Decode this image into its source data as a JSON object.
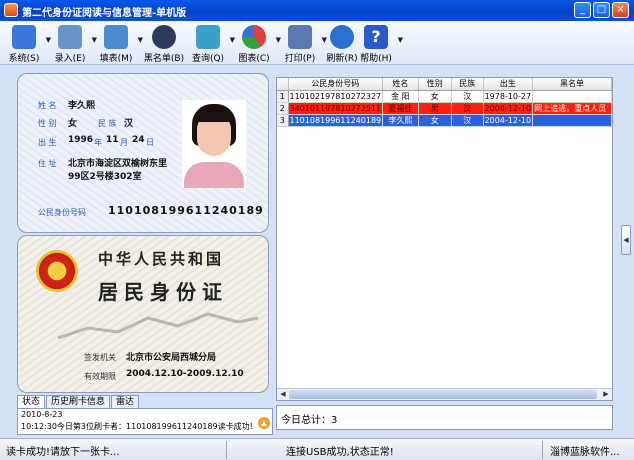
{
  "window": {
    "title": "第二代身份证阅读与信息管理-单机版",
    "min": "_",
    "max": "□",
    "close": "×"
  },
  "toolbar": [
    {
      "label": "系统(S)",
      "icon": "monitor-icon",
      "color": "#3a78d8",
      "has_dropdown": true
    },
    {
      "label": "录入(E)",
      "icon": "pen-icon",
      "color": "#6a94c8",
      "has_dropdown": true
    },
    {
      "label": "填表(M)",
      "icon": "clipboard-icon",
      "color": "#4a8ad0",
      "has_dropdown": true
    },
    {
      "label": "黑名单(B)",
      "icon": "person-icon",
      "color": "#2a3a5a",
      "has_dropdown": false
    },
    {
      "label": "查询(Q)",
      "icon": "search-document-icon",
      "color": "#3aa0c8",
      "has_dropdown": true
    },
    {
      "label": "图表(C)",
      "icon": "pie-chart-icon",
      "color": "#e04040",
      "has_dropdown": true
    },
    {
      "label": "打印(P)",
      "icon": "printer-icon",
      "color": "#5a7ab0",
      "has_dropdown": true
    },
    {
      "label": "刷新(R)",
      "icon": "refresh-icon",
      "color": "#2a70d0",
      "has_dropdown": false
    },
    {
      "label": "帮助(H)",
      "icon": "help-icon",
      "color": "#2a5ac8",
      "has_dropdown": true
    }
  ],
  "card": {
    "name_label": "姓 名",
    "name": "李久熙",
    "sex_label": "性 别",
    "sex": "女",
    "nation_label": "民 族",
    "nation": "汉",
    "birth_label": "出 生",
    "birth_year": "1996",
    "year_unit": "年",
    "birth_month": "11",
    "month_unit": "月",
    "birth_day": "24",
    "day_unit": "日",
    "address_label": "住 址",
    "address_line1": "北京市海淀区双榆树东里",
    "address_line2": "99区2号楼302室",
    "id_label": "公民身份号码",
    "id_number": "110108199611240189",
    "back_title1": "中华人民共和国",
    "back_title2": "居民身份证",
    "authority_label": "签发机关",
    "authority": "北京市公安局西城分局",
    "valid_label": "有效期限",
    "valid": "2004.12.10-2009.12.10"
  },
  "tabs": [
    "状态",
    "历史刷卡信息",
    "雷达"
  ],
  "log": {
    "date": "2010-8-23",
    "entry": "10:12:30今日第3位刷卡者：110108199611240189读卡成功!"
  },
  "table": {
    "headers": [
      "",
      "公民身份号码",
      "姓名",
      "性别",
      "民族",
      "出生",
      "黑名单"
    ],
    "rows": [
      {
        "num": "1",
        "id": "110102197810272327",
        "name": "金 阳",
        "sex": "女",
        "nation": "汉",
        "birth": "1978-10-27",
        "blacklist": "",
        "style": "normal"
      },
      {
        "num": "2",
        "id": "340101197810272511",
        "name": "夏福佳",
        "sex": "男",
        "nation": "汉",
        "birth": "2004-12-10",
        "blacklist": "网上追逃，重点人员",
        "style": "red"
      },
      {
        "num": "3",
        "id": "110108199611240189",
        "name": "李久熙",
        "sex": "女",
        "nation": "汉",
        "birth": "2004-12-10",
        "blacklist": "",
        "style": "sel"
      }
    ]
  },
  "today": {
    "label": "今日总计：",
    "count": "3"
  },
  "statusbar": {
    "left": "读卡成功!请放下一张卡...",
    "middle": "连接USB成功,状态正常!",
    "right": "淄博蓝脉软件..."
  }
}
